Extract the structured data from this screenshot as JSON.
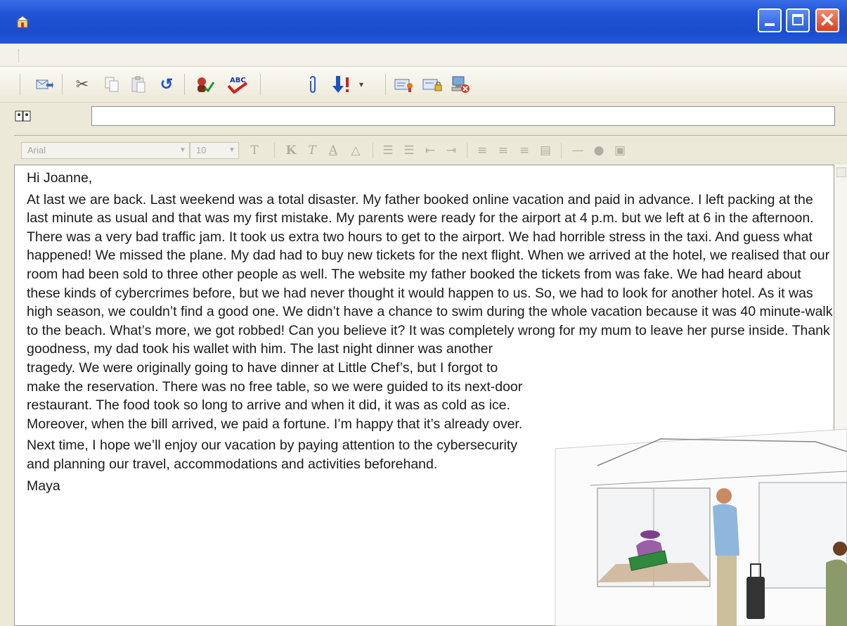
{
  "window": {
    "controls": [
      "minimize-icon",
      "maximize-icon",
      "close-icon"
    ],
    "accent": "#1f54d6"
  },
  "toolbar": {
    "buttons": [
      "send-icon",
      "cut-icon",
      "copy-icon",
      "paste-icon",
      "undo-icon",
      "check-names-icon",
      "spelling-icon",
      "attach-icon",
      "priority-icon",
      "sign-icon",
      "encrypt-icon",
      "offline-icon"
    ],
    "spelling_label": "ABC"
  },
  "address": {
    "value": ""
  },
  "format": {
    "font": "Arial",
    "size": "10"
  },
  "message": {
    "greeting": "Hi Joanne,",
    "paragraph1": "At last we are back. Last weekend was a total disaster. My father booked online vacation and paid in advance. I left packing at the last minute as usual and that was my first mistake. My parents were ready for the airport at 4 p.m. but we left at 6 in the afternoon. There was a very bad traffic jam. It took us extra two hours to get to the airport. We had horrible stress in the taxi. And guess what happened! We missed the plane. My dad had to buy new tickets for the next flight. When we arrived at the hotel, we realised that our room had been sold to three other people as well. The website my father booked the tickets from was fake. We had heard about these kinds of cybercrimes before, but we had never thought it would happen to us. So, we had to look for another hotel. As it was high season, we couldn’t find a good one.  We didn’t have a chance to swim during the whole vacation because it was 40 minute-walk to the beach. What’s more, we got robbed! Can you believe it? It was completely wrong for my mum to leave her purse inside. Thank",
    "paragraph1_cont": "goodness, my dad took his wallet with him. The last night dinner was another tragedy. We were originally going to have dinner at Little Chef’s, but I forgot to make the reservation. There was no free table, so we were guided to its next-door restaurant. The food took so long to arrive and when it did, it was as cold as ice. Moreover, when the bill arrived, we paid a fortune. I’m happy that it’s already over.",
    "paragraph2": "Next time, I hope we’ll enjoy our vacation by paying attention to the cybersecurity and planning our travel, accommodations and activities beforehand.",
    "signature": "Maya"
  }
}
